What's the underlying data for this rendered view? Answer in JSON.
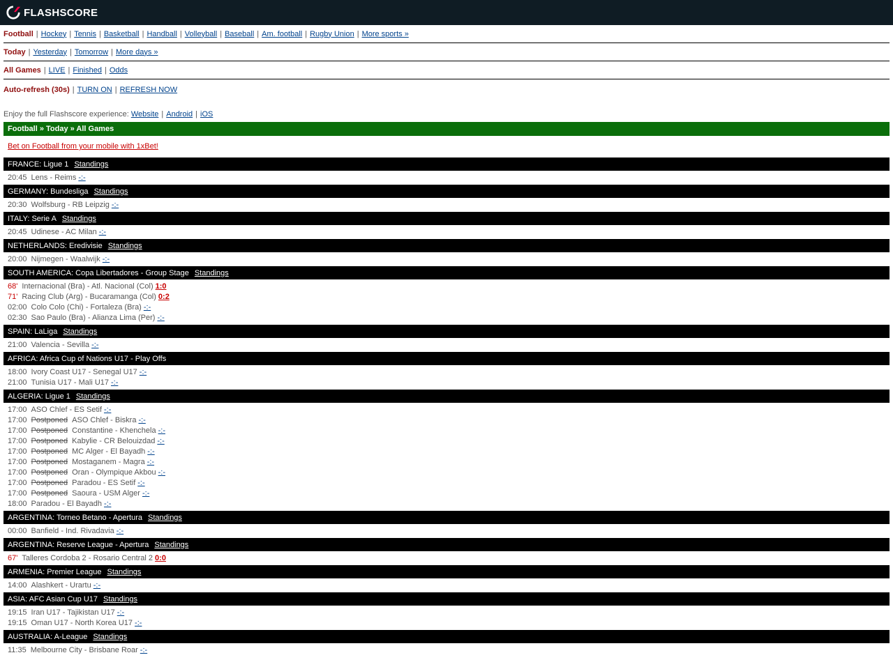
{
  "brand": {
    "name": "FLASHSCORE"
  },
  "sports_nav": {
    "items": [
      "Football",
      "Hockey",
      "Tennis",
      "Basketball",
      "Handball",
      "Volleyball",
      "Baseball",
      "Am. football",
      "Rugby Union",
      "More sports »"
    ],
    "active": "Football"
  },
  "days_nav": {
    "items": [
      "Today",
      "Yesterday",
      "Tomorrow",
      "More days »"
    ],
    "active": "Today"
  },
  "filter_nav": {
    "items": [
      "All Games",
      "LIVE",
      "Finished",
      "Odds"
    ],
    "active": "All Games"
  },
  "refresh": {
    "label": "Auto-refresh (30s)",
    "turn_on": "TURN ON",
    "refresh_now": "REFRESH NOW"
  },
  "enjoy": {
    "text": "Enjoy the full Flashscore experience:",
    "links": [
      "Website",
      "Android",
      "iOS"
    ]
  },
  "breadcrumb": "Football » Today » All Games",
  "promo": "Bet on Football from your mobile with 1xBet!",
  "standings_label": "Standings",
  "leagues": [
    {
      "name": "FRANCE: Ligue 1",
      "standings": true,
      "matches": [
        {
          "time": "20:45",
          "teams": "Lens - Reims",
          "score": "-:-"
        }
      ]
    },
    {
      "name": "GERMANY: Bundesliga",
      "standings": true,
      "matches": [
        {
          "time": "20:30",
          "teams": "Wolfsburg - RB Leipzig",
          "score": "-:-"
        }
      ]
    },
    {
      "name": "ITALY: Serie A",
      "standings": true,
      "matches": [
        {
          "time": "20:45",
          "teams": "Udinese - AC Milan",
          "score": "-:-"
        }
      ]
    },
    {
      "name": "NETHERLANDS: Eredivisie",
      "standings": true,
      "matches": [
        {
          "time": "20:00",
          "teams": "Nijmegen - Waalwijk",
          "score": "-:-"
        }
      ]
    },
    {
      "name": "SOUTH AMERICA: Copa Libertadores - Group Stage",
      "standings": true,
      "matches": [
        {
          "live": "68'",
          "teams": "Internacional (Bra) - Atl. Nacional (Col)",
          "score": "1:0"
        },
        {
          "live": "71'",
          "teams": "Racing Club (Arg) - Bucaramanga (Col)",
          "score": "0:2"
        },
        {
          "time": "02:00",
          "teams": "Colo Colo (Chi) - Fortaleza (Bra)",
          "score": "-:-"
        },
        {
          "time": "02:30",
          "teams": "Sao Paulo (Bra) - Alianza Lima (Per)",
          "score": "-:-"
        }
      ]
    },
    {
      "name": "SPAIN: LaLiga",
      "standings": true,
      "matches": [
        {
          "time": "21:00",
          "teams": "Valencia - Sevilla",
          "score": "-:-"
        }
      ]
    },
    {
      "name": "AFRICA: Africa Cup of Nations U17 - Play Offs",
      "standings": false,
      "matches": [
        {
          "time": "18:00",
          "teams": "Ivory Coast U17 - Senegal U17",
          "score": "-:-"
        },
        {
          "time": "21:00",
          "teams": "Tunisia U17 - Mali U17",
          "score": "-:-"
        }
      ]
    },
    {
      "name": "ALGERIA: Ligue 1",
      "standings": true,
      "matches": [
        {
          "time": "17:00",
          "teams": "ASO Chlef - ES Setif",
          "score": "-:-"
        },
        {
          "time": "17:00",
          "status": "Postponed",
          "teams": "ASO Chlef - Biskra",
          "score": "-:-"
        },
        {
          "time": "17:00",
          "status": "Postponed",
          "teams": "Constantine - Khenchela",
          "score": "-:-"
        },
        {
          "time": "17:00",
          "status": "Postponed",
          "teams": "Kabylie - CR Belouizdad",
          "score": "-:-"
        },
        {
          "time": "17:00",
          "status": "Postponed",
          "teams": "MC Alger - El Bayadh",
          "score": "-:-"
        },
        {
          "time": "17:00",
          "status": "Postponed",
          "teams": "Mostaganem - Magra",
          "score": "-:-"
        },
        {
          "time": "17:00",
          "status": "Postponed",
          "teams": "Oran - Olympique Akbou",
          "score": "-:-"
        },
        {
          "time": "17:00",
          "status": "Postponed",
          "teams": "Paradou - ES Setif",
          "score": "-:-"
        },
        {
          "time": "17:00",
          "status": "Postponed",
          "teams": "Saoura - USM Alger",
          "score": "-:-"
        },
        {
          "time": "18:00",
          "teams": "Paradou - El Bayadh",
          "score": "-:-"
        }
      ]
    },
    {
      "name": "ARGENTINA: Torneo Betano - Apertura",
      "standings": true,
      "matches": [
        {
          "time": "00:00",
          "teams": "Banfield - Ind. Rivadavia",
          "score": "-:-"
        }
      ]
    },
    {
      "name": "ARGENTINA: Reserve League - Apertura",
      "standings": true,
      "matches": [
        {
          "live": "67'",
          "teams": "Talleres Cordoba 2 - Rosario Central 2",
          "score": "0:0"
        }
      ]
    },
    {
      "name": "ARMENIA: Premier League",
      "standings": true,
      "matches": [
        {
          "time": "14:00",
          "teams": "Alashkert - Urartu",
          "score": "-:-"
        }
      ]
    },
    {
      "name": "ASIA: AFC Asian Cup U17",
      "standings": true,
      "matches": [
        {
          "time": "19:15",
          "teams": "Iran U17 - Tajikistan U17",
          "score": "-:-"
        },
        {
          "time": "19:15",
          "teams": "Oman U17 - North Korea U17",
          "score": "-:-"
        }
      ]
    },
    {
      "name": "AUSTRALIA: A-League",
      "standings": true,
      "matches": [
        {
          "time": "11:35",
          "teams": "Melbourne City - Brisbane Roar",
          "score": "-:-"
        }
      ]
    }
  ]
}
